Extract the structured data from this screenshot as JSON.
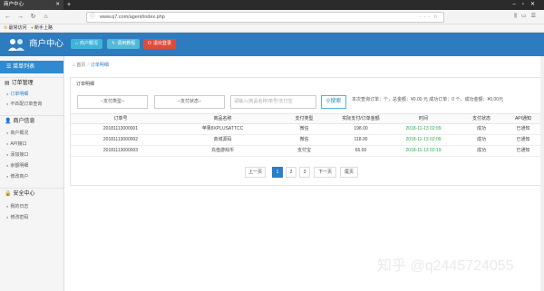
{
  "browser": {
    "tab_title": "商户中心",
    "url": "www.q7.com/agent/index.php",
    "bookmarks": [
      "最常访问",
      "新手上路"
    ]
  },
  "header": {
    "app_title": "商户中心",
    "buttons": [
      "商户概况",
      "调用教程",
      "退出登录"
    ]
  },
  "sidebar": {
    "menu_title": "菜单列表",
    "groups": [
      {
        "label": "订单管理",
        "items": [
          "订单明细",
          "不匹配订单查询"
        ]
      },
      {
        "label": "商户信息",
        "items": [
          "商户概况",
          "API接口",
          "添加接口",
          "余额明细",
          "修改商户"
        ]
      },
      {
        "label": "安全中心",
        "items": [
          "我的日志",
          "修改密码"
        ]
      }
    ]
  },
  "breadcrumb": {
    "home": "首页",
    "current": "订单明细"
  },
  "panel": {
    "title": "订单明细",
    "filter": {
      "pay_type_select": "--支付类型--",
      "pay_status_select": "--支付状态--",
      "search_placeholder": "请输入(商品名称/单号/支付宝",
      "search_button": "搜索"
    },
    "stats": "本次查询订单：个，总金额：¥0.00 元 成功订单：0 个，成功金额：¥0.00元"
  },
  "table": {
    "columns": [
      "订单号",
      "商品名称",
      "支付类型",
      "实际支付/订单金额",
      "时间",
      "支付状态",
      "API通知"
    ],
    "rows": [
      [
        "20181113000001",
        "苹果8XPLUSATTCC",
        "微信",
        "198.00",
        "2018-11-13 02:09",
        "成功",
        "已通知"
      ],
      [
        "20181113000002",
        "商城源码",
        "微信",
        "118.00",
        "2018-11-13 02:09",
        "成功",
        "已通知"
      ],
      [
        "20181113000003",
        "充值游戏币",
        "支付宝",
        "65.00",
        "2018-11-13 02:19",
        "成功",
        "已通知"
      ]
    ]
  },
  "pagination": {
    "prev": "上一页",
    "pages": [
      "1",
      "2",
      "3"
    ],
    "next": "下一页",
    "last": "尾页",
    "current": "1"
  },
  "watermark": "知乎 @q2445724055",
  "colors": {
    "header": "#2e7cc0",
    "menu_active": "#2f8ad0",
    "time_text": "#2aa84a",
    "page_active": "#2a7fc9"
  }
}
